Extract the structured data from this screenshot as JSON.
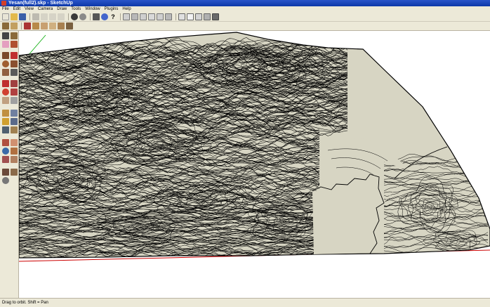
{
  "window": {
    "title": "Yesan(full2).skp - SketchUp"
  },
  "menu": [
    "File",
    "Edit",
    "View",
    "Camera",
    "Draw",
    "Tools",
    "Window",
    "Plugins",
    "Help"
  ],
  "status": {
    "hint": "Drag to orbit.  Shift = Pan"
  },
  "colors": {
    "terrain": "#d7d5c3",
    "contour": "#000000",
    "axis_red": "#cc0000",
    "axis_green": "#00aa00",
    "chrome": "#ece9d8"
  }
}
